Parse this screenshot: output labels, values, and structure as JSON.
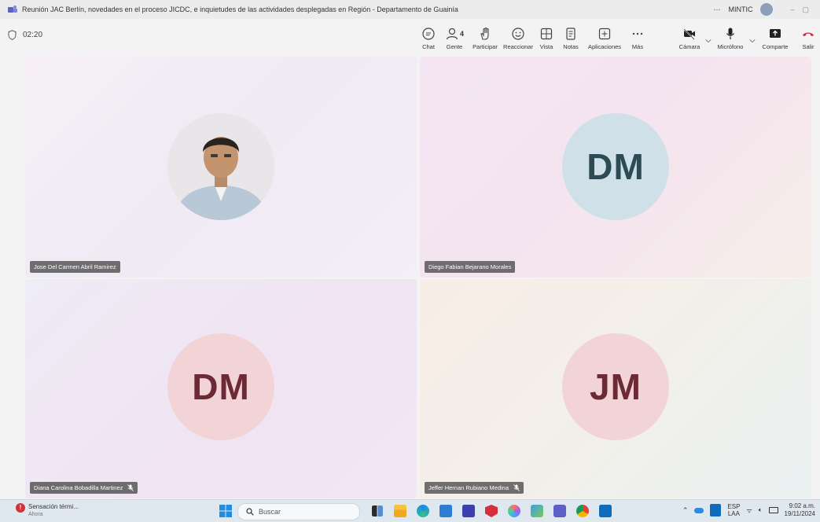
{
  "window": {
    "title": "Reunión JAC Berlín, novedades en el proceso JICDC, e inquietudes de las actividades desplegadas en Región - Departamento de Guainía",
    "more": "···",
    "org": "MINTIC",
    "minimize": "–",
    "restore": "▢"
  },
  "meeting": {
    "timer": "02:20",
    "people_count": "4"
  },
  "toolbar": {
    "chat": "Chat",
    "people": "Gente",
    "raise": "Participar",
    "react": "Reaccionar",
    "view": "Vista",
    "notes": "Notas",
    "apps": "Aplicaciones",
    "more": "Más",
    "camera": "Cámara",
    "mic": "Micrófono",
    "share": "Comparte",
    "leave": "Salir"
  },
  "participants": [
    {
      "name": "Jose Del Carmen Abril Ramirez",
      "initials": "",
      "muted": false,
      "has_photo": true,
      "avatar_bg": "#e8e2ea"
    },
    {
      "name": "Diego Fabian Bejarano Morales",
      "initials": "DM",
      "muted": false,
      "has_photo": false,
      "avatar_bg": "#cfe0e8",
      "initials_color": "#2d4a55"
    },
    {
      "name": "Diana Carolina Bobadilla Martinez",
      "initials": "DM",
      "muted": true,
      "has_photo": false,
      "avatar_bg": "#f3d4d6",
      "initials_color": "#6b2a35"
    },
    {
      "name": "Jeffer Hernan Rubiano Medina",
      "initials": "JM",
      "muted": true,
      "has_photo": false,
      "avatar_bg": "#f3d4d6",
      "initials_color": "#6b2a35"
    }
  ],
  "taskbar": {
    "weather_title": "Sensación térmi...",
    "weather_sub": "Ahora",
    "search_placeholder": "Buscar",
    "lang_top": "ESP",
    "lang_bottom": "LAA",
    "time": "9:02 a.m.",
    "date": "19/11/2024"
  },
  "colors": {
    "leave": "#c4314b",
    "accent": "#5b5fc7"
  }
}
